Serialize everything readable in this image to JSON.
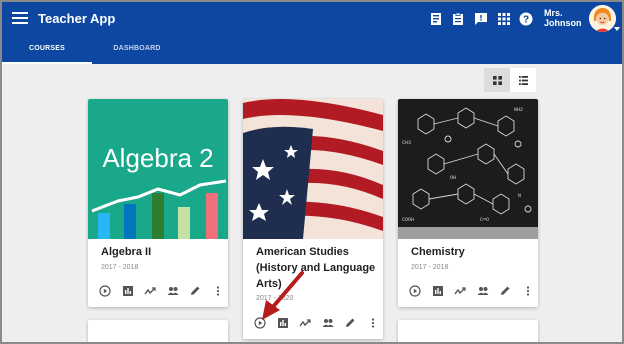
{
  "appbar": {
    "title": "Teacher App",
    "user_name": "Mrs. Johnson",
    "icons": [
      "book-icon",
      "clipboard-icon",
      "feedback-icon",
      "apps-icon",
      "help-icon"
    ]
  },
  "tabs": [
    {
      "label": "COURSES",
      "active": true
    },
    {
      "label": "DASHBOARD",
      "active": false
    }
  ],
  "view_toggle": {
    "selected": "grid"
  },
  "courses": [
    {
      "title": "Algebra II",
      "image_text": "Algebra 2",
      "year": "2017 - 2018"
    },
    {
      "title": "American Studies (History and Language Arts)",
      "year": "2017 - 2020"
    },
    {
      "title": "Chemistry",
      "year": "2017 - 2018"
    }
  ],
  "card_actions": [
    "play-icon",
    "report-icon",
    "trending-icon",
    "people-icon",
    "edit-icon",
    "more-icon"
  ],
  "colors": {
    "appbar": "#0d47a1",
    "background": "#eeeeee",
    "algebra_bg": "#1aa88a",
    "annotation_arrow": "#b71c1c"
  }
}
